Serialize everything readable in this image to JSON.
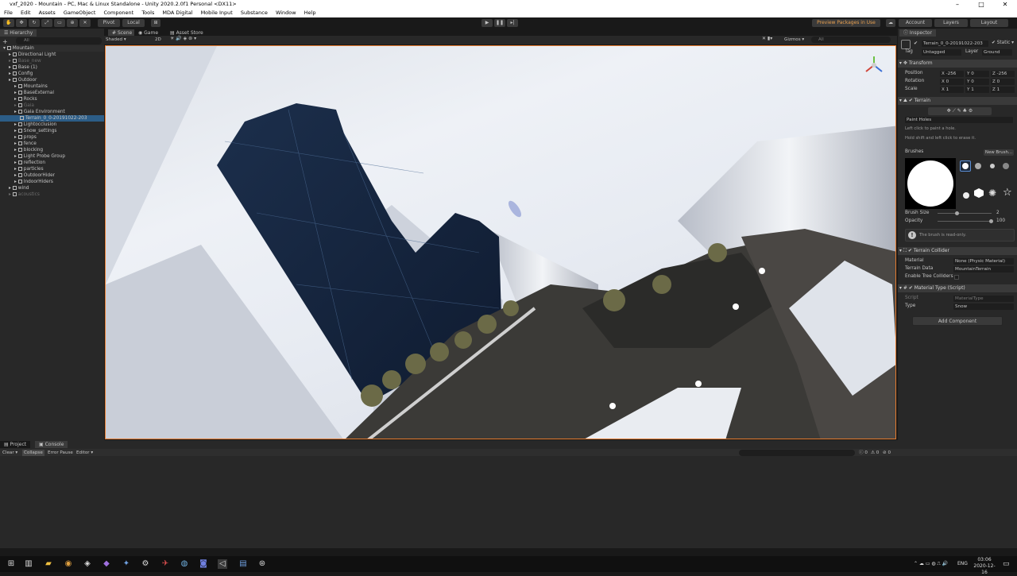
{
  "window": {
    "title": "vxf_2020 - Mountain - PC, Mac & Linux Standalone - Unity 2020.2.0f1 Personal <DX11>"
  },
  "menu": [
    "File",
    "Edit",
    "Assets",
    "GameObject",
    "Component",
    "Tools",
    "MDA Digital",
    "Mobile Input",
    "Substance",
    "Window",
    "Help"
  ],
  "toolbar": {
    "pivot": "Pivot",
    "local": "Local",
    "preview_packages": "Preview Packages in Use",
    "account": "Account",
    "layers": "Layers",
    "layout": "Layout"
  },
  "hierarchy": {
    "tab": "Hierarchy",
    "search_placeholder": "All",
    "scene": "Mountain",
    "items": [
      {
        "label": "Directional Light",
        "indent": 1
      },
      {
        "label": "Base_new",
        "indent": 1,
        "dim": true
      },
      {
        "label": "Base (1)",
        "indent": 1
      },
      {
        "label": "Config",
        "indent": 1
      },
      {
        "label": "Outdoor",
        "indent": 1
      },
      {
        "label": "Mountains",
        "indent": 2
      },
      {
        "label": "BaseExternal",
        "indent": 2
      },
      {
        "label": "Rocks",
        "indent": 2
      },
      {
        "label": "Gaia",
        "indent": 2,
        "dim": true
      },
      {
        "label": "Gaia Environment",
        "indent": 2
      },
      {
        "label": "Terrain_0_0-20191022-203",
        "indent": 3,
        "selected": true
      },
      {
        "label": "Lightocclusion",
        "indent": 2
      },
      {
        "label": "Snow_settings",
        "indent": 2
      },
      {
        "label": "props",
        "indent": 2
      },
      {
        "label": "fence",
        "indent": 2
      },
      {
        "label": "blocking",
        "indent": 2
      },
      {
        "label": "Light Probe Group",
        "indent": 2
      },
      {
        "label": "reflection",
        "indent": 2
      },
      {
        "label": "particles",
        "indent": 2
      },
      {
        "label": "OutdoorHider",
        "indent": 2
      },
      {
        "label": "IndoorHiders",
        "indent": 2
      },
      {
        "label": "wind",
        "indent": 1
      },
      {
        "label": "acoustics",
        "indent": 1,
        "dim": true
      }
    ]
  },
  "scene": {
    "tabs": [
      "Scene",
      "Game",
      "Asset Store"
    ],
    "shading": "Shaded",
    "mode_2d": "2D",
    "gizmos": "Gizmos",
    "search_placeholder": "All"
  },
  "inspector": {
    "tab": "Inspector",
    "object_name": "Terrain_0_0-20191022-203",
    "static_label": "Static",
    "tag_label": "Tag",
    "tag_value": "Untagged",
    "layer_label": "Layer",
    "layer_value": "Ground",
    "transform": {
      "title": "Transform",
      "position": {
        "label": "Position",
        "x": "-256",
        "y": "0",
        "z": "-256"
      },
      "rotation": {
        "label": "Rotation",
        "x": "0",
        "y": "0",
        "z": "0"
      },
      "scale": {
        "label": "Scale",
        "x": "1",
        "y": "1",
        "z": "1"
      }
    },
    "terrain": {
      "title": "Terrain",
      "tool": "Paint Holes",
      "hint1": "Left click to paint a hole.",
      "hint2": "Hold shift and left click to erase it.",
      "brushes_label": "Brushes",
      "new_brush": "New Brush...",
      "brush_size_label": "Brush Size",
      "brush_size": "2",
      "opacity_label": "Opacity",
      "opacity": "100",
      "readonly_msg": "The brush is read-only."
    },
    "collider": {
      "title": "Terrain Collider",
      "material_label": "Material",
      "material_value": "None (Physic Material)",
      "data_label": "Terrain Data",
      "data_value": "MountainTerrain",
      "trees_label": "Enable Tree Colliders"
    },
    "material_type": {
      "title": "Material Type (Script)",
      "script_label": "Script",
      "script_value": "MaterialType",
      "type_label": "Type",
      "type_value": "Snow"
    },
    "add_component": "Add Component"
  },
  "console": {
    "tabs": [
      "Project",
      "Console"
    ],
    "clear": "Clear",
    "collapse": "Collapse",
    "error_pause": "Error Pause",
    "editor": "Editor",
    "counts": [
      "0",
      "0",
      "0"
    ]
  },
  "taskbar": {
    "time": "03:06",
    "date": "2020-12-16",
    "lang": "ENG"
  },
  "colors": {
    "accent": "#e47a2e",
    "selection": "#2c5d87",
    "panel": "#282828"
  }
}
